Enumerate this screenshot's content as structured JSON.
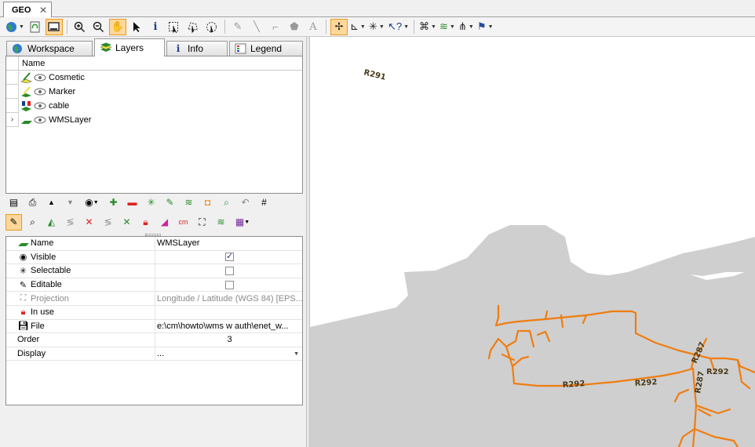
{
  "document_tab": {
    "title": "GEO",
    "close": "✕"
  },
  "panel_tabs": [
    {
      "label": "Workspace",
      "icon": "globe-icon"
    },
    {
      "label": "Layers",
      "icon": "layers-icon"
    },
    {
      "label": "Info",
      "icon": "info-icon"
    },
    {
      "label": "Legend",
      "icon": "legend-icon"
    }
  ],
  "layers": {
    "column_header": "Name",
    "items": [
      {
        "name": "Cosmetic",
        "icon": "cosmetic-layer-icon"
      },
      {
        "name": "Marker",
        "icon": "marker-layer-icon"
      },
      {
        "name": "cable",
        "icon": "cable-layer-icon"
      },
      {
        "name": "WMSLayer",
        "icon": "wms-layer-icon",
        "expander": "›"
      }
    ]
  },
  "properties": {
    "rows": [
      {
        "key": "Name",
        "value": "WMSLayer"
      },
      {
        "key": "Visible",
        "checked": true
      },
      {
        "key": "Selectable",
        "checked": false
      },
      {
        "key": "Editable",
        "checked": false
      },
      {
        "key": "Projection",
        "value": "Longitude / Latitude (WGS 84) [EPS...",
        "disabled": true
      },
      {
        "key": "In use",
        "value": ""
      },
      {
        "key": "File",
        "value": "e:\\cm\\howto\\wms w auth\\enet_w..."
      },
      {
        "key": "Order",
        "value": "3"
      },
      {
        "key": "Display",
        "value": "..."
      }
    ]
  },
  "map": {
    "labels": [
      "R291",
      "R292",
      "R292",
      "R287",
      "R292",
      "R287"
    ],
    "colors": {
      "land": "#cfcfcf",
      "cable": "#f07d10",
      "background": "#ffffff"
    }
  }
}
